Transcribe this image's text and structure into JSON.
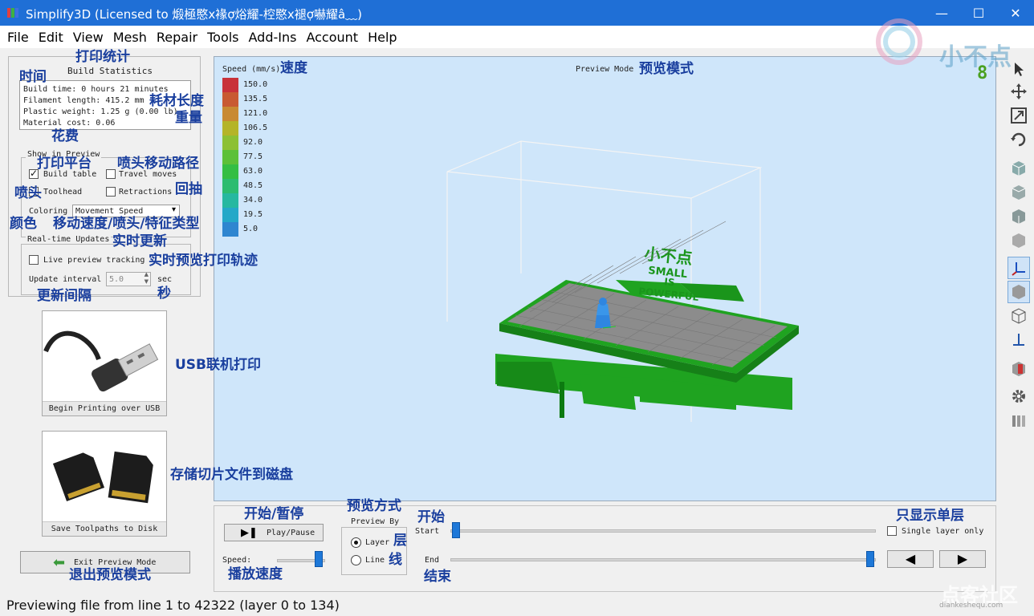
{
  "window": {
    "title": "Simplify3D (Licensed to 煅極愍x褖ợ焀耀-椌愍x褪ợ嚇耀â﹏)",
    "controls": [
      "—",
      "☐",
      "✕"
    ]
  },
  "menu": [
    "File",
    "Edit",
    "View",
    "Mesh",
    "Repair",
    "Tools",
    "Add-Ins",
    "Account",
    "Help"
  ],
  "build_statistics": {
    "title": "Build Statistics",
    "lines": [
      "Build time: 0 hours 21 minutes",
      "Filament length: 415.2 mm",
      "Plastic weight: 1.25 g (0.00 lb)",
      "Material cost: 0.06"
    ]
  },
  "show_in_preview": {
    "title": "Show in Preview",
    "build_table": {
      "label": "Build table",
      "checked": true
    },
    "travel_moves": {
      "label": "Travel moves",
      "checked": false
    },
    "toolhead": {
      "label": "Toolhead",
      "checked": false
    },
    "retractions": {
      "label": "Retractions",
      "checked": false
    },
    "coloring_label": "Coloring",
    "coloring_value": "Movement Speed"
  },
  "realtime": {
    "title": "Real-time Updates",
    "live_preview": {
      "label": "Live preview tracking",
      "checked": false
    },
    "interval_label": "Update interval",
    "interval_value": "5.0",
    "interval_unit": "sec"
  },
  "usb_button": {
    "label": "Begin Printing over USB"
  },
  "save_button": {
    "label": "Save Toolpaths to Disk"
  },
  "exit_button": {
    "label": "Exit Preview Mode"
  },
  "viewport": {
    "speed_title": "Speed (mm/s)",
    "mode_label": "Preview Mode",
    "legend": [
      {
        "value": "150.0",
        "color": "#c8323a"
      },
      {
        "value": "135.5",
        "color": "#c85a32"
      },
      {
        "value": "121.0",
        "color": "#c88a32"
      },
      {
        "value": "106.5",
        "color": "#b4b428"
      },
      {
        "value": "92.0",
        "color": "#8cc034"
      },
      {
        "value": "77.5",
        "color": "#5cc038"
      },
      {
        "value": "63.0",
        "color": "#34be44"
      },
      {
        "value": "48.5",
        "color": "#2cbc70"
      },
      {
        "value": "34.0",
        "color": "#26b8a0"
      },
      {
        "value": "19.5",
        "color": "#24a8c8"
      },
      {
        "value": "5.0",
        "color": "#2f86d0"
      }
    ],
    "layer_indicator": "8",
    "model_text": [
      "小不点",
      "SMALL",
      "IS",
      "POWERFUL"
    ]
  },
  "playback": {
    "play_label": "Play/Pause",
    "speed_label": "Speed:",
    "preview_by": {
      "title": "Preview By",
      "layer": {
        "label": "Layer",
        "checked": true
      },
      "line": {
        "label": "Line",
        "checked": false
      }
    },
    "start_label": "Start",
    "end_label": "End",
    "single_layer": {
      "label": "Single layer only",
      "checked": false
    },
    "prev_icon": "◀",
    "next_icon": "▶"
  },
  "status": "Previewing file from line 1 to 42322 (layer 0 to 134)",
  "annotations": {
    "print_stats": "打印统计",
    "time": "时间",
    "filament_length": "耗材长度",
    "weight": "重量",
    "cost": "花费",
    "build_platform": "打印平台",
    "travel_path": "喷头移动路径",
    "nozzle": "喷头",
    "retract": "回抽",
    "color": "颜色",
    "color_type": "移动速度/喷头/特征类型",
    "realtime_update": "实时更新",
    "realtime_preview": "实时预览打印轨迹",
    "update_interval": "更新间隔",
    "seconds": "秒",
    "usb_print": "USB联机打印",
    "save_disk": "存储切片文件到磁盘",
    "exit_preview": "退出预览模式",
    "speed": "速度",
    "preview_mode": "预览模式",
    "start_pause": "开始/暂停",
    "preview_method": "预览方式",
    "layer": "层",
    "line": "线",
    "start": "开始",
    "end": "结束",
    "playback_speed": "播放速度",
    "single_layer": "只显示单层"
  },
  "watermark": {
    "top": "小不点",
    "bottom_cn": "点客社区",
    "bottom_en": "diankeshequ.com"
  }
}
